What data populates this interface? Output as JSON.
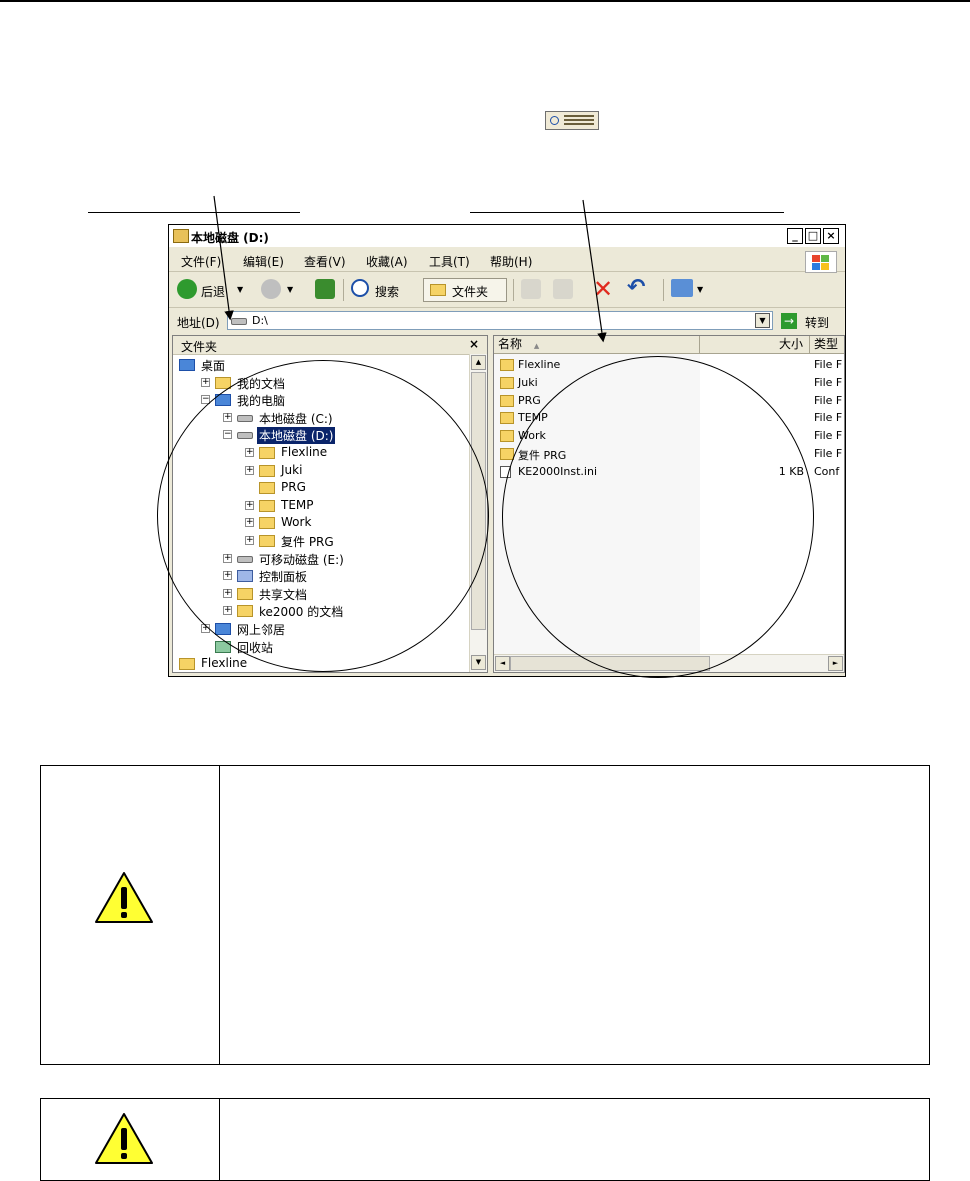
{
  "explorer": {
    "title": "本地磁盘 (D:)",
    "window_buttons": {
      "minimize": "_",
      "maximize": "□",
      "close": "×"
    },
    "menu": [
      "文件(F)",
      "编辑(E)",
      "查看(V)",
      "收藏(A)",
      "工具(T)",
      "帮助(H)"
    ],
    "nav": {
      "back": "后退",
      "search": "搜索",
      "folders": "文件夹"
    },
    "address": {
      "label": "地址(D)",
      "value": "D:\\",
      "go": "转到"
    },
    "tree_panel": {
      "title": "文件夹",
      "close": "×",
      "items": [
        {
          "label": "桌面",
          "indent": 0,
          "expander": "",
          "icon": "desktop-icon"
        },
        {
          "label": "我的文档",
          "indent": 1,
          "expander": "+",
          "icon": "my-documents-icon"
        },
        {
          "label": "我的电脑",
          "indent": 1,
          "expander": "−",
          "icon": "my-computer-icon"
        },
        {
          "label": "本地磁盘 (C:)",
          "indent": 2,
          "expander": "+",
          "icon": "drive-icon"
        },
        {
          "label": "本地磁盘 (D:)",
          "indent": 2,
          "expander": "−",
          "icon": "drive-icon",
          "selected": true
        },
        {
          "label": "Flexline",
          "indent": 3,
          "expander": "+",
          "icon": "folder-icon"
        },
        {
          "label": "Juki",
          "indent": 3,
          "expander": "+",
          "icon": "folder-icon"
        },
        {
          "label": "PRG",
          "indent": 3,
          "expander": "",
          "icon": "folder-icon"
        },
        {
          "label": "TEMP",
          "indent": 3,
          "expander": "+",
          "icon": "folder-icon"
        },
        {
          "label": "Work",
          "indent": 3,
          "expander": "+",
          "icon": "folder-icon"
        },
        {
          "label": "复件 PRG",
          "indent": 3,
          "expander": "+",
          "icon": "folder-icon"
        },
        {
          "label": "可移动磁盘 (E:)",
          "indent": 2,
          "expander": "+",
          "icon": "removable-drive-icon"
        },
        {
          "label": "控制面板",
          "indent": 2,
          "expander": "+",
          "icon": "control-panel-icon"
        },
        {
          "label": "共享文档",
          "indent": 2,
          "expander": "+",
          "icon": "folder-icon"
        },
        {
          "label": "ke2000 的文档",
          "indent": 2,
          "expander": "+",
          "icon": "folder-icon"
        },
        {
          "label": "网上邻居",
          "indent": 1,
          "expander": "+",
          "icon": "network-icon"
        },
        {
          "label": "回收站",
          "indent": 1,
          "expander": "",
          "icon": "recycle-bin-icon"
        },
        {
          "label": "Flexline",
          "indent": 0,
          "expander": "+",
          "icon": "folder-icon"
        }
      ]
    },
    "file_list": {
      "columns": {
        "name": "名称",
        "size": "大小",
        "type": "类型"
      },
      "sort_indicator": "▲",
      "rows": [
        {
          "name": "Flexline",
          "size": "",
          "type": "File F",
          "icon": "folder-icon"
        },
        {
          "name": "Juki",
          "size": "",
          "type": "File F",
          "icon": "folder-icon"
        },
        {
          "name": "PRG",
          "size": "",
          "type": "File F",
          "icon": "folder-icon"
        },
        {
          "name": "TEMP",
          "size": "",
          "type": "File F",
          "icon": "folder-icon"
        },
        {
          "name": "Work",
          "size": "",
          "type": "File F",
          "icon": "folder-icon"
        },
        {
          "name": "复件 PRG",
          "size": "",
          "type": "File F",
          "icon": "folder-icon"
        },
        {
          "name": "KE2000Inst.ini",
          "size": "1 KB",
          "type": "Conf",
          "icon": "ini-file-icon"
        }
      ]
    }
  },
  "scroll_arrows": {
    "up": "▲",
    "down": "▼",
    "left": "◄",
    "right": "►",
    "dropdown": "▼",
    "go": "→"
  },
  "colors": {
    "selection": "#0a246a",
    "warning_yellow": "#ffff33",
    "go_green": "#2e9a2e"
  }
}
